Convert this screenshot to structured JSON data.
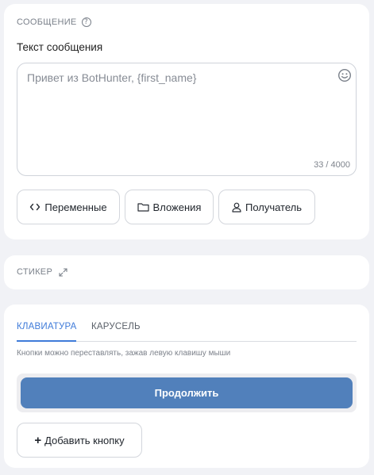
{
  "message": {
    "section_title": "СООБЩЕНИЕ",
    "help_icon": "?",
    "field_label": "Текст сообщения",
    "text_value": "Привет из BotHunter, {first_name}",
    "counter": "33 / 4000",
    "buttons": [
      {
        "label": "Переменные",
        "icon": "code-icon"
      },
      {
        "label": "Вложения",
        "icon": "folder-icon"
      },
      {
        "label": "Получатель",
        "icon": "user-icon"
      }
    ]
  },
  "sticker": {
    "section_title": "СТИКЕР",
    "icon": "expand-icon"
  },
  "keyboard": {
    "tabs": [
      {
        "label": "КЛАВИАТУРА",
        "active": true
      },
      {
        "label": "КАРУСЕЛЬ",
        "active": false
      }
    ],
    "hint": "Кнопки можно переставлять, зажав левую клавишу мыши",
    "buttons": [
      {
        "label": "Продолжить"
      }
    ],
    "add_button": {
      "label": "Добавить кнопку",
      "icon": "plus-icon"
    }
  },
  "colors": {
    "background": "#f1f2f6",
    "accent": "#3f7bd9",
    "primary_button": "#5180bb"
  }
}
